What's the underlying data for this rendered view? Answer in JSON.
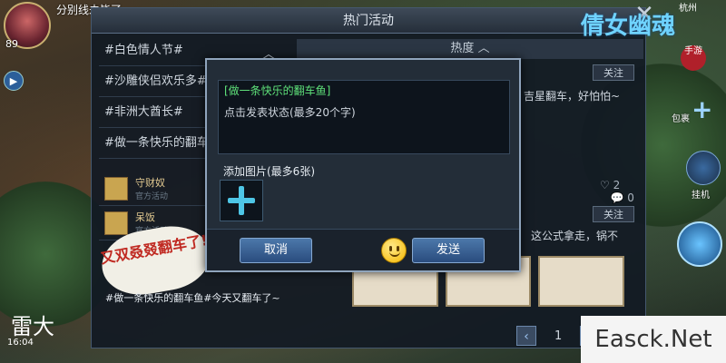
{
  "game": {
    "player_level": "89",
    "player_name": "分别线未毕了",
    "logo_text": "倩女幽魂",
    "logo_sub": "手游",
    "city": "杭州",
    "time": "16:04",
    "brand_bottom": "雷大",
    "side": {
      "pack_label": "包裹",
      "hangup_label": "挂机"
    }
  },
  "panel": {
    "title": "热门活动",
    "topics": [
      "#白色情人节#",
      "#沙雕侠侣欢乐多#",
      "#非洲大酋长#",
      "#做一条快乐的翻车鱼"
    ],
    "mini_posts": [
      {
        "name": "守财奴",
        "sub": "官方活动"
      },
      {
        "name": "呆饭",
        "sub": "官方活动"
      }
    ],
    "sticker_text": "又双叒叕翻车了!",
    "post_caption": "#做一条快乐的翻车鱼#今天又翻车了~",
    "heat_label": "热度",
    "follow_label": "关注",
    "post_text_1": "吉星翻车，好怕怕~",
    "post_text_2": "这公式拿走，锅不",
    "likes": "2",
    "comments": "0",
    "page": "1"
  },
  "dialog": {
    "topic_tag": "[做一条快乐的翻车鱼]",
    "hint": "点击发表状态(最多20个字)",
    "add_image_label": "添加图片(最多6张)",
    "cancel_label": "取消",
    "send_label": "发送"
  },
  "watermark": "Easck.Net"
}
